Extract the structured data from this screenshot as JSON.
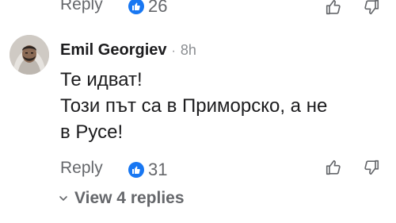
{
  "previous_comment": {
    "reply_label": "Reply",
    "like_count": "26",
    "like_icon": "thumbs-up-icon",
    "upvote_icon": "thumbs-up-outline-icon",
    "downvote_icon": "thumbs-down-outline-icon"
  },
  "comment": {
    "author": "Emil Georgiev",
    "separator": "·",
    "time": "8h",
    "avatar_icon": "user-avatar",
    "lines": [
      "Те идват!",
      "Този път са в Приморско, а не",
      "в Русе!"
    ],
    "reply_label": "Reply",
    "like_count": "31",
    "like_icon": "thumbs-up-icon",
    "upvote_icon": "thumbs-up-outline-icon",
    "downvote_icon": "thumbs-down-outline-icon",
    "view_replies_label": "View 4 replies",
    "chevron_icon": "chevron-down-icon"
  },
  "colors": {
    "text": "#1c1c1e",
    "muted": "#65676b",
    "like_blue": "#1877f2",
    "background": "#ffffff"
  }
}
